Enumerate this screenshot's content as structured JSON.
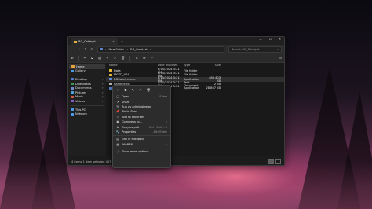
{
  "window": {
    "tab_title": "RG_Catalyst",
    "tab_close": "×",
    "new_tab": "+",
    "controls": [
      "—",
      "☐",
      "✕"
    ]
  },
  "nav": {
    "back": "←",
    "forward": "→",
    "up": "↑",
    "refresh": "⟳",
    "breadcrumb": [
      "New Folder",
      "RG_Catalyst"
    ],
    "search_placeholder": "Search RG_Catalyst",
    "search_icon": "⌕"
  },
  "toolbar": {
    "new_label": "⊕",
    "cut": "✂",
    "copy": "⧉",
    "paste": "▤",
    "rename": "✎",
    "share": "↗",
    "delete": "🗑",
    "sort": "⇅",
    "view": "☰",
    "more": "···",
    "details": "▭"
  },
  "sidebar": {
    "items": [
      {
        "label": "Home",
        "color": "#e8a33d",
        "selected": true
      },
      {
        "label": "Gallery",
        "color": "#4c9be8"
      },
      {
        "label": "Desktop",
        "color": "#4c7fd0",
        "pinned": true
      },
      {
        "label": "Downloads",
        "color": "#3f9a56",
        "pinned": true
      },
      {
        "label": "Documents",
        "color": "#6f8ccf",
        "pinned": true
      },
      {
        "label": "Pictures",
        "color": "#4aa3d8",
        "pinned": true
      },
      {
        "label": "Music",
        "color": "#d2574a",
        "pinned": true
      },
      {
        "label": "Videos",
        "color": "#8a5ad0",
        "pinned": true
      },
      {
        "label": "This PC",
        "color": "#4c9be8"
      },
      {
        "label": "Network",
        "color": "#4c9be8"
      }
    ],
    "pin_glyph": "📌"
  },
  "files": {
    "headers": [
      "Name",
      "Date modified",
      "Type",
      "Size"
    ],
    "rows": [
      {
        "name": "Data",
        "date": "8/15/2024 3:21 PM",
        "type": "File folder",
        "size": "",
        "color": "#e8b93d"
      },
      {
        "name": "MGSD_V24",
        "date": "8/15/2024 3:21 PM",
        "type": "File folder",
        "size": "",
        "color": "#e8b93d"
      },
      {
        "name": "RGCatalyst.exe",
        "date": "8/15/2024 3:21 PM",
        "type": "Application",
        "size": "489,403 KB",
        "color": "#5a8ad8",
        "selected": true
      },
      {
        "name": "Readme.txt",
        "date": "8/15/2024 3:21 PM",
        "type": "Text Document",
        "size": "2 KB",
        "color": "#bbbbbb"
      },
      {
        "name": "unins000",
        "date": "8/15/2024 3:21 PM",
        "type": "Application",
        "size": "28,867 KB",
        "color": "#5a8ad8"
      }
    ]
  },
  "statusbar": {
    "text": "4 items   1 item selected  467 MB"
  },
  "context_menu": {
    "top_icons": [
      "✂",
      "⧉",
      "✎",
      "↗",
      "🗑"
    ],
    "items": [
      {
        "label": "Open",
        "shortcut": "Enter",
        "icon": "▢"
      },
      {
        "label": "Share",
        "icon": "↗"
      },
      {
        "label": "Run as administrator",
        "icon": "⛨"
      },
      {
        "label": "Pin to Start",
        "icon": "📌"
      },
      {
        "label": "Add to Favorites",
        "icon": "☆"
      },
      {
        "label": "Compress to...",
        "arrow": "›",
        "icon": "▣"
      },
      {
        "label": "Copy as path",
        "shortcut": "Ctrl+Shift+C",
        "icon": "⧉"
      },
      {
        "label": "Properties",
        "shortcut": "Alt+Enter",
        "icon": "🔧"
      },
      {
        "label": "Edit in Notepad",
        "icon": "▤"
      },
      {
        "label": "WinRAR",
        "arrow": "›",
        "icon": "▦"
      },
      {
        "label": "Show more options",
        "icon": "⤢"
      }
    ]
  }
}
